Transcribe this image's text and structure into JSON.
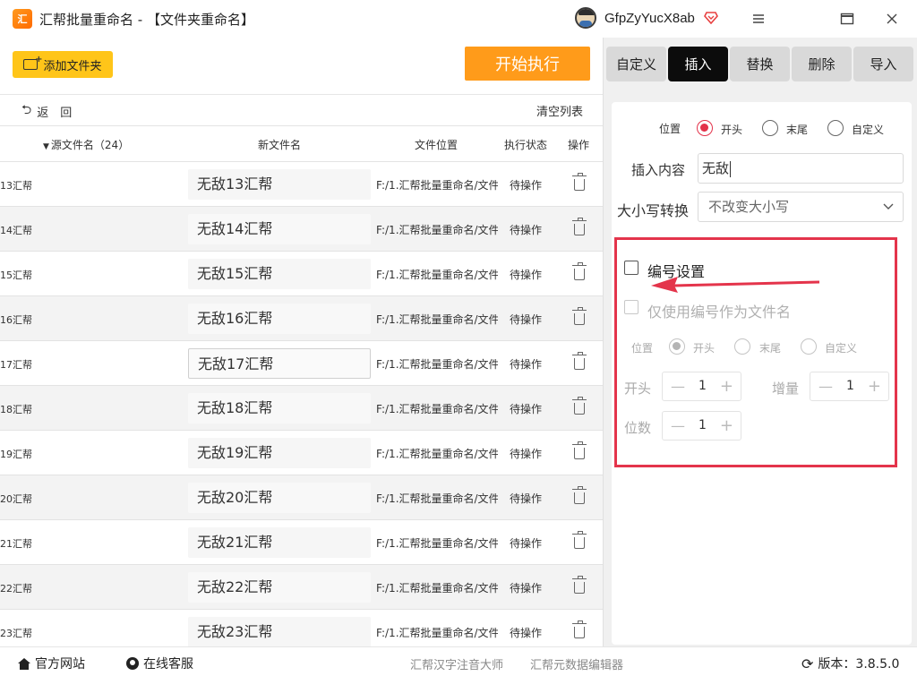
{
  "app": {
    "title": "汇帮批量重命名 - 【文件夹重命名】",
    "username": "GfpZyYucX8ab"
  },
  "toolbar": {
    "add_folder": "添加文件夹",
    "start": "开始执行",
    "back": "返　回",
    "clear_list": "清空列表"
  },
  "table": {
    "headers": {
      "source": "源文件名（24）",
      "new_name": "新文件名",
      "location": "文件位置",
      "status": "执行状态",
      "action": "操作"
    },
    "rows": [
      {
        "source": "13汇帮",
        "new_name": "无敌13汇帮",
        "location": "F:/1.汇帮批量重命名/文件",
        "status": "待操作"
      },
      {
        "source": "14汇帮",
        "new_name": "无敌14汇帮",
        "location": "F:/1.汇帮批量重命名/文件",
        "status": "待操作"
      },
      {
        "source": "15汇帮",
        "new_name": "无敌15汇帮",
        "location": "F:/1.汇帮批量重命名/文件",
        "status": "待操作"
      },
      {
        "source": "16汇帮",
        "new_name": "无敌16汇帮",
        "location": "F:/1.汇帮批量重命名/文件",
        "status": "待操作"
      },
      {
        "source": "17汇帮",
        "new_name": "无敌17汇帮",
        "location": "F:/1.汇帮批量重命名/文件",
        "status": "待操作"
      },
      {
        "source": "18汇帮",
        "new_name": "无敌18汇帮",
        "location": "F:/1.汇帮批量重命名/文件",
        "status": "待操作"
      },
      {
        "source": "19汇帮",
        "new_name": "无敌19汇帮",
        "location": "F:/1.汇帮批量重命名/文件",
        "status": "待操作"
      },
      {
        "source": "20汇帮",
        "new_name": "无敌20汇帮",
        "location": "F:/1.汇帮批量重命名/文件",
        "status": "待操作"
      },
      {
        "source": "21汇帮",
        "new_name": "无敌21汇帮",
        "location": "F:/1.汇帮批量重命名/文件",
        "status": "待操作"
      },
      {
        "source": "22汇帮",
        "new_name": "无敌22汇帮",
        "location": "F:/1.汇帮批量重命名/文件",
        "status": "待操作"
      },
      {
        "source": "23汇帮",
        "new_name": "无敌23汇帮",
        "location": "F:/1.汇帮批量重命名/文件",
        "status": "待操作"
      }
    ]
  },
  "tabs": [
    "自定义",
    "插入",
    "替换",
    "删除",
    "导入"
  ],
  "active_tab": "插入",
  "insert": {
    "position_label": "位置",
    "position_options": [
      "开头",
      "末尾",
      "自定义"
    ],
    "position_selected": "开头",
    "content_label": "插入内容",
    "content_value": "无敌",
    "case_label": "大小写转换",
    "case_value": "不改变大小写"
  },
  "numbering": {
    "enable_label": "编号设置",
    "only_number_label": "仅使用编号作为文件名",
    "position_label": "位置",
    "position_options": [
      "开头",
      "末尾",
      "自定义"
    ],
    "start_label": "开头",
    "start_value": "1",
    "increment_label": "增量",
    "increment_value": "1",
    "digits_label": "位数",
    "digits_value": "1"
  },
  "statusbar": {
    "website": "官方网站",
    "support": "在线客服",
    "tool1": "汇帮汉字注音大师",
    "tool2": "汇帮元数据编辑器",
    "version": "版本：3.8.5.0"
  },
  "colors": {
    "accent_orange": "#ff9b1a",
    "add_button_yellow": "#ffc519",
    "highlight_red": "#e4344b",
    "active_tab": "#0c0c0c"
  }
}
